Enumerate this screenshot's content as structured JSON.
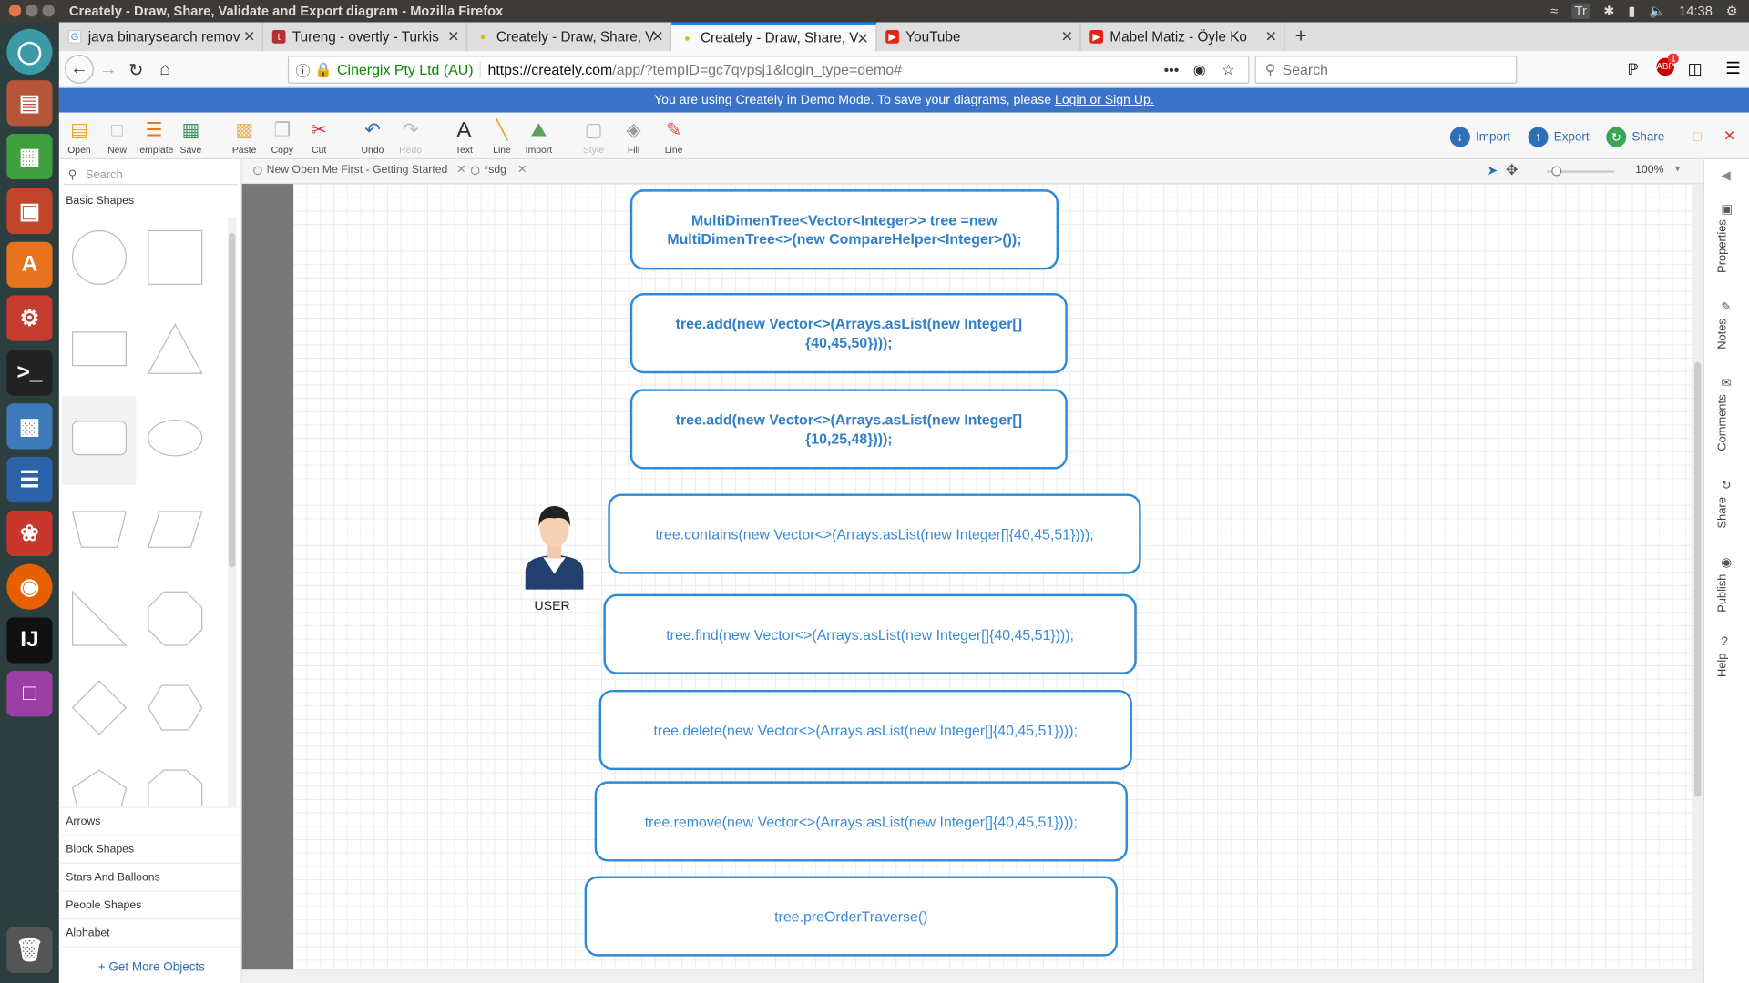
{
  "system": {
    "window_title": "Creately - Draw, Share, Validate and Export diagram - Mozilla Firefox",
    "clock": "14:38",
    "tray_tr": "Tr"
  },
  "launcher": [
    "ubuntu-dash-icon",
    "files-icon",
    "spreadsheet-icon",
    "presentation-icon",
    "software-center-icon",
    "settings-icon",
    "terminal-icon",
    "virtualbox-icon",
    "writer-icon",
    "document-viewer-icon",
    "firefox-icon",
    "intellij-icon",
    "workspace-icon",
    "trash-icon"
  ],
  "browser": {
    "tabs": [
      {
        "label": "java binarysearch remov",
        "favicon": "G"
      },
      {
        "label": "Tureng - overtly - Turkis",
        "favicon": "t"
      },
      {
        "label": "Creately - Draw, Share, V",
        "favicon": "●"
      },
      {
        "label": "Creately - Draw, Share, V",
        "favicon": "●"
      },
      {
        "label": "YouTube",
        "favicon": "▶"
      },
      {
        "label": "Mabel Matiz - Öyle Ko",
        "favicon": "▶"
      }
    ],
    "site_identity": "Cinergix Pty Ltd (AU)",
    "url_host": "https://creately.com",
    "url_path": "/app/?tempID=gc7qvpsj1&login_type=demo#",
    "search_placeholder": "Search",
    "badge_count": "1"
  },
  "banner": {
    "text": "You are using Creately in Demo Mode. To save your diagrams, please ",
    "link": "Login or Sign Up."
  },
  "toolbar": {
    "open": "Open",
    "new": "New",
    "template": "Template",
    "save": "Save",
    "paste": "Paste",
    "copy": "Copy",
    "cut": "Cut",
    "undo": "Undo",
    "redo": "Redo",
    "text": "Text",
    "line": "Line",
    "import": "Import",
    "style": "Style",
    "fill": "Fill",
    "line2": "Line",
    "import_btn": "Import",
    "export_btn": "Export",
    "share_btn": "Share"
  },
  "leftpanel": {
    "search_placeholder": "Search",
    "title": "Basic Shapes",
    "categories": [
      "Arrows",
      "Block Shapes",
      "Stars And Balloons",
      "People Shapes",
      "Alphabet"
    ],
    "get_more": "+ Get More Objects"
  },
  "doctabs": [
    "New Open Me First - Getting Started",
    "*sdg"
  ],
  "zoom": "100%",
  "diagram": {
    "nodes": [
      "MultiDimenTree<Vector<Integer>> tree =new MultiDimenTree<>(new CompareHelper<Integer>());",
      "tree.add(new Vector<>(Arrays.asList(new Integer[]{40,45,50})));",
      "tree.add(new Vector<>(Arrays.asList(new Integer[]{10,25,48})));",
      "tree.contains(new Vector<>(Arrays.asList(new Integer[]{40,45,51})));",
      "tree.find(new Vector<>(Arrays.asList(new Integer[]{40,45,51})));",
      "tree.delete(new Vector<>(Arrays.asList(new Integer[]{40,45,51})));",
      "tree.remove(new Vector<>(Arrays.asList(new Integer[]{40,45,51})));",
      "tree.preOrderTraverse()"
    ],
    "user_label": "USER"
  },
  "rightrail": [
    "Properties",
    "Notes",
    "Comments",
    "Share",
    "Publish",
    "Help"
  ],
  "colors": {
    "accent": "#2c8ad8",
    "banner": "#3b73c8",
    "launcher": "#2d3e3e"
  }
}
